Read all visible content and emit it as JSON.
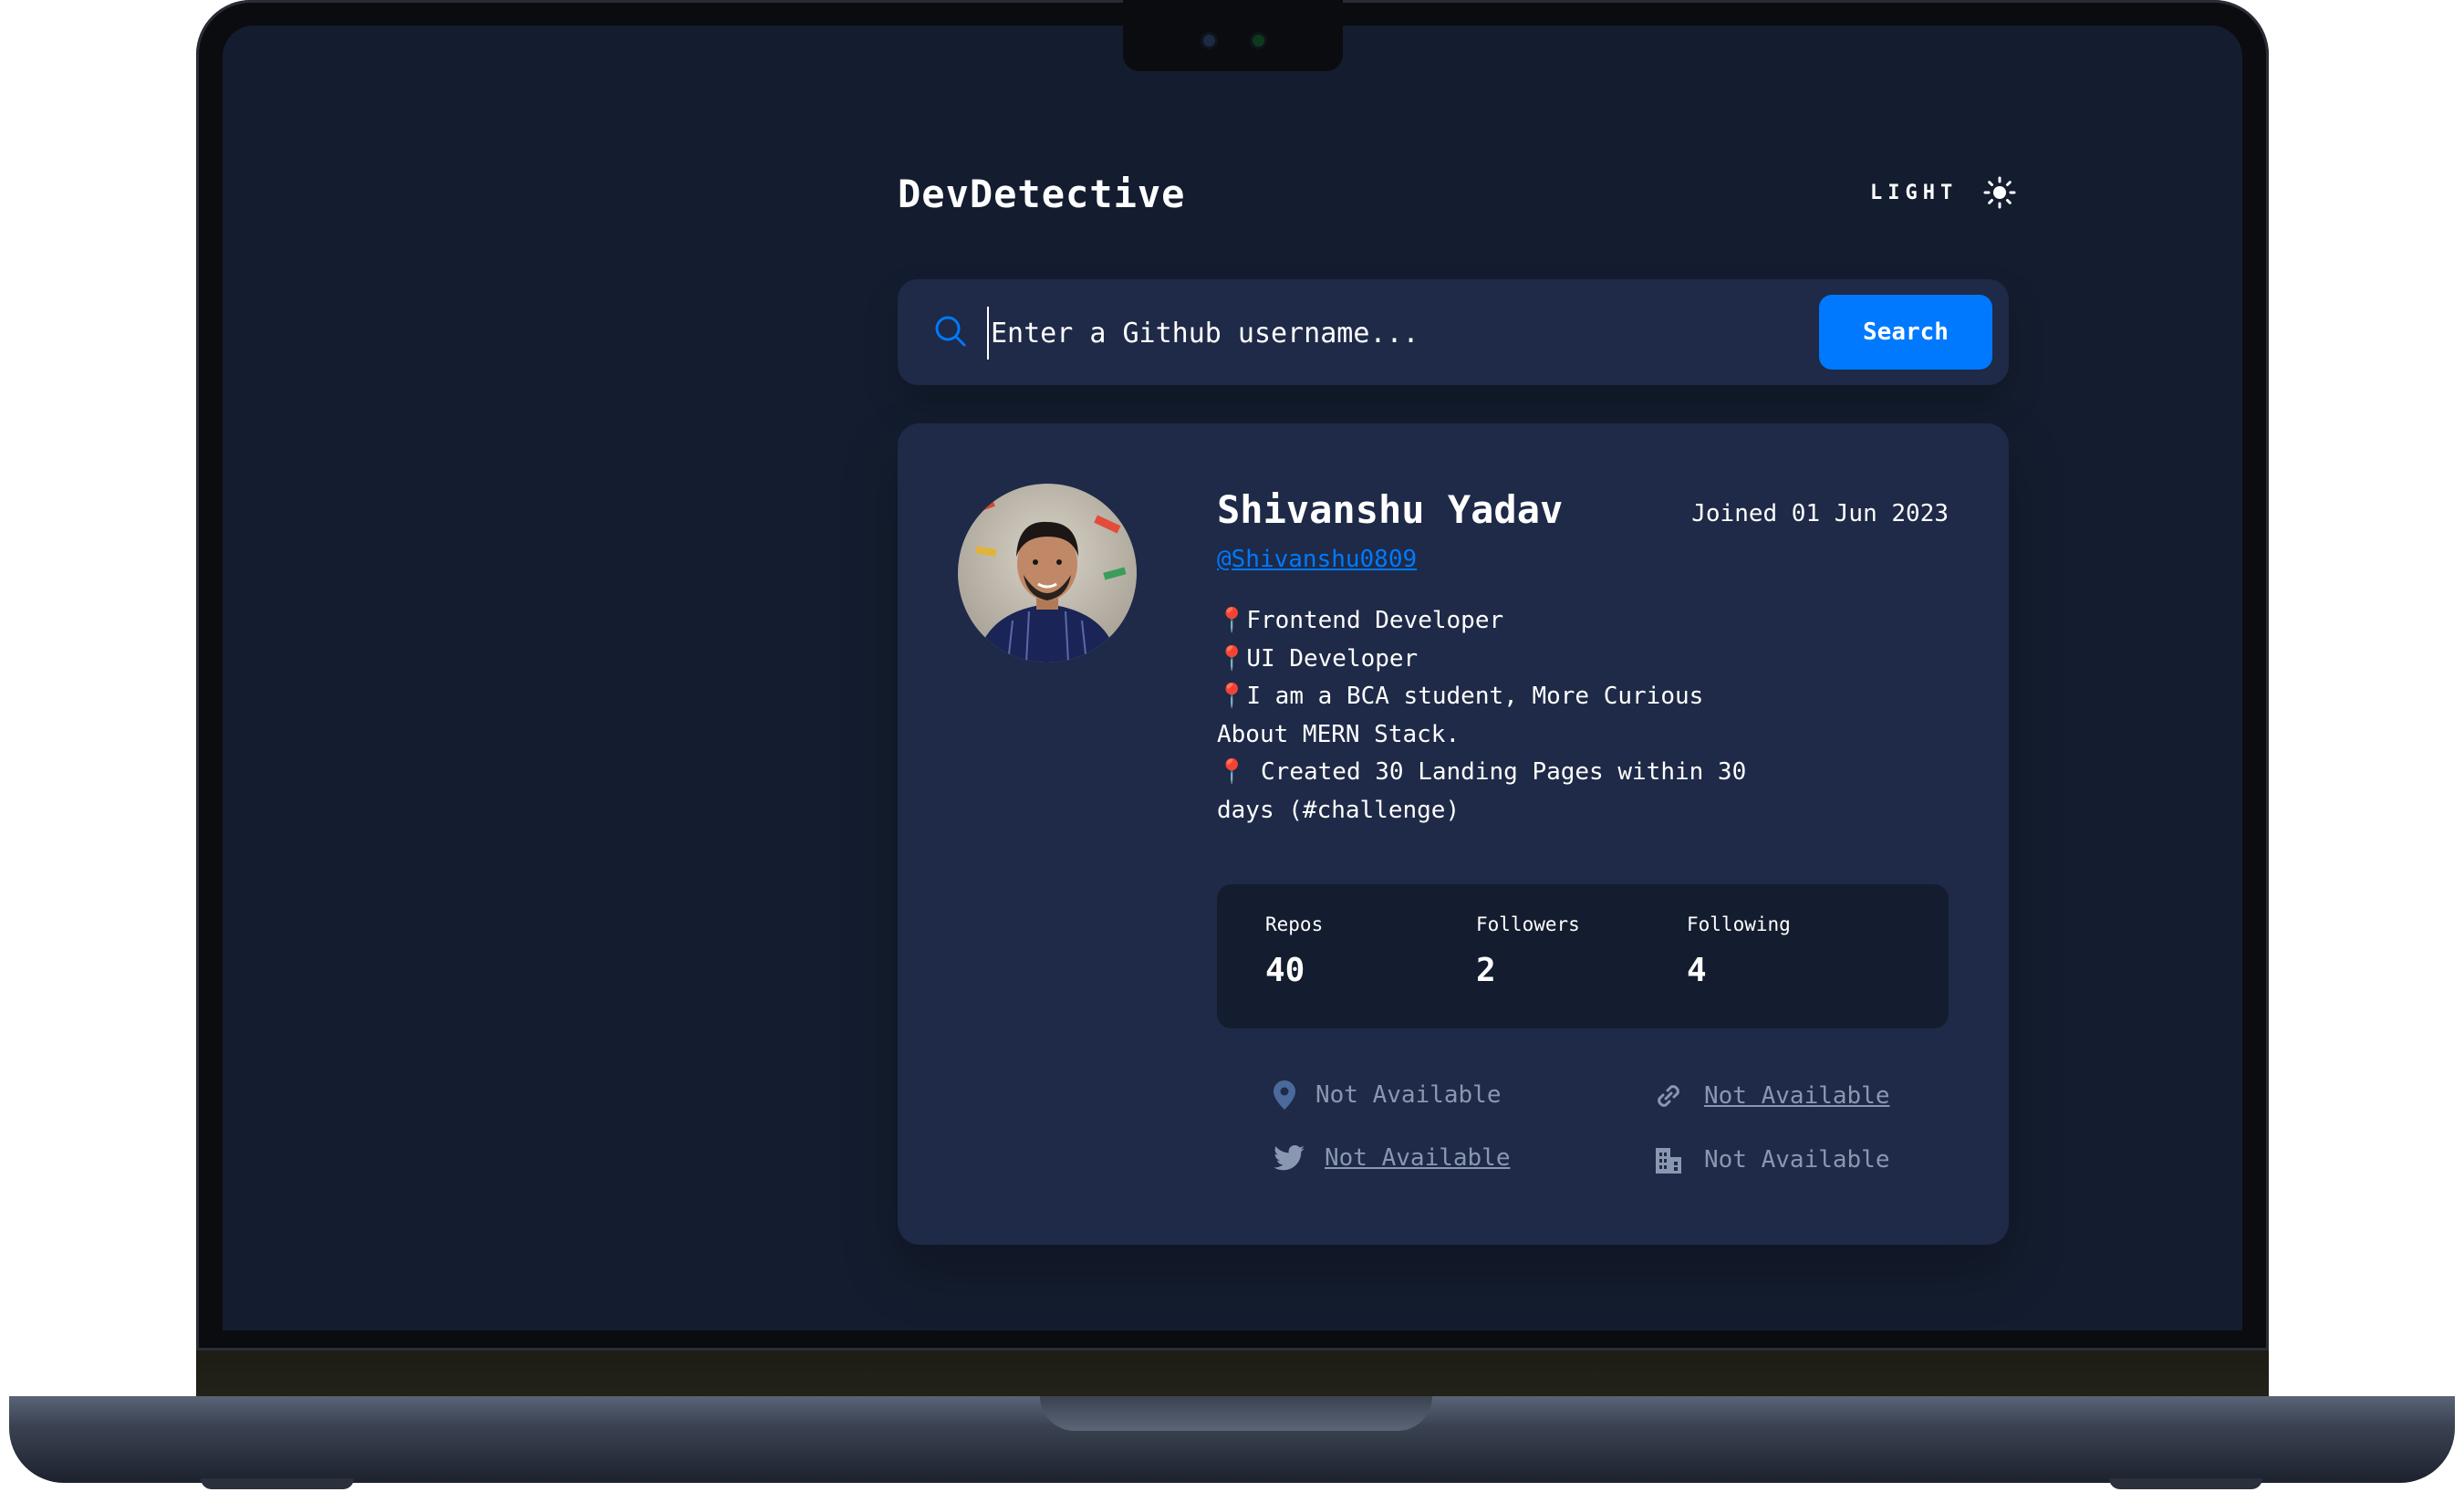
{
  "app": {
    "title": "DevDetective",
    "theme_label": "LIGHT",
    "theme_icon": "sun-icon"
  },
  "search": {
    "placeholder": "Enter a Github username...",
    "button_label": "Search"
  },
  "profile": {
    "name": "Shivanshu Yadav",
    "joined": "Joined 01 Jun 2023",
    "login": "@Shivanshu0809",
    "bio": [
      "📍Frontend Developer",
      "📍UI Developer",
      "📍I am a BCA student, More Curious",
      "About MERN Stack.",
      "📍 Created 30 Landing Pages within 30",
      "days (#challenge)"
    ],
    "stats": [
      {
        "label": "Repos",
        "value": "40"
      },
      {
        "label": "Followers",
        "value": "2"
      },
      {
        "label": "Following",
        "value": "4"
      }
    ],
    "links": {
      "location": "Not Available",
      "website": "Not Available",
      "twitter": "Not Available",
      "company": "Not Available"
    }
  },
  "colors": {
    "background": "#141d2f",
    "card": "#1e2a47",
    "accent": "#0079ff",
    "text": "#ffffff",
    "muted": "#8a97b1"
  }
}
